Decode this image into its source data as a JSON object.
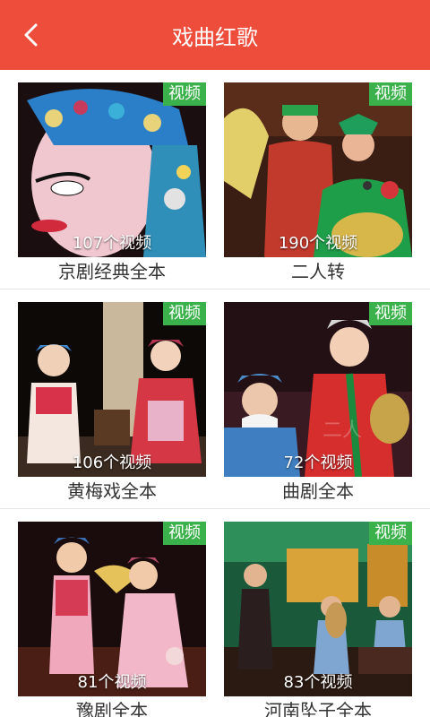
{
  "header": {
    "title": "戏曲红歌",
    "back_icon": "chevron-left-icon",
    "bg_color": "#ee4d3b"
  },
  "badge_color": "#3ab14a",
  "items": [
    {
      "name": "京剧经典全本",
      "count": "107个视频",
      "badge": "视频"
    },
    {
      "name": "二人转",
      "count": "190个视频",
      "badge": "视频"
    },
    {
      "name": "黄梅戏全本",
      "count": "106个视频",
      "badge": "视频"
    },
    {
      "name": "曲剧全本",
      "count": "72个视频",
      "badge": "视频"
    },
    {
      "name": "豫剧全本",
      "count": "81个视频",
      "badge": "视频"
    },
    {
      "name": "河南坠子全本",
      "count": "83个视频",
      "badge": "视频"
    }
  ]
}
